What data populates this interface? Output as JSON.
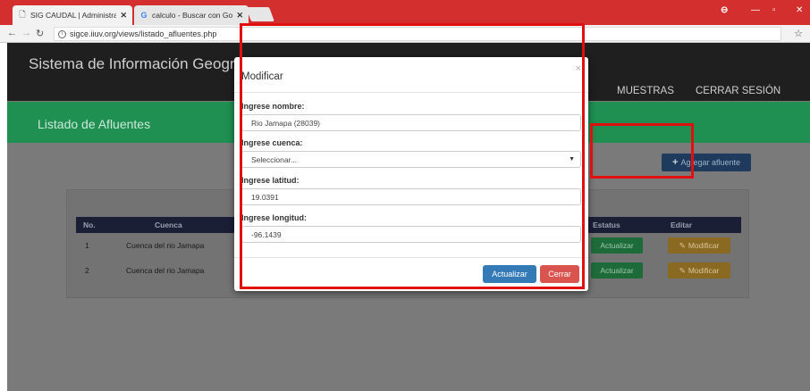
{
  "browser": {
    "tabs": [
      {
        "title": "SIG CAUDAL | Administra",
        "close": "✕"
      },
      {
        "title": "calculo - Buscar con Goo",
        "close": "✕"
      }
    ],
    "url": "sigce.iiuv.org/views/listado_afluentes.php",
    "window_controls": {
      "minimize": "—",
      "restore": "▫",
      "close": "✕"
    }
  },
  "page": {
    "site_title": "Sistema de Información Geogr",
    "nav": [
      "MUESTRAS",
      "CERRAR SESIÓN"
    ],
    "band_title": "Listado de Afluentes",
    "add_button": "Agregar afluente",
    "table": {
      "headers": [
        "No.",
        "Cuenca",
        "Estatus",
        "Editar"
      ],
      "rows": [
        {
          "no": "1",
          "cuenca": "Cuenca del rio Jamapa",
          "estatus": "Actualizar",
          "editar": "Modificar"
        },
        {
          "no": "2",
          "cuenca": "Cuenca del rio Jamapa",
          "estatus": "Actualizar",
          "editar": "Modificar"
        }
      ]
    }
  },
  "modal": {
    "title": "Modificar",
    "close": "×",
    "fields": {
      "nombre_label": "Ingrese nombre:",
      "nombre_value": "Rio Jamapa (28039)",
      "cuenca_label": "Ingrese cuenca:",
      "cuenca_value": "Seleccionar...",
      "latitud_label": "Ingrese latitud:",
      "latitud_value": "19.0391",
      "longitud_label": "Ingrese longitud:",
      "longitud_value": "-96.1439"
    },
    "buttons": {
      "update": "Actualizar",
      "cancel": "Cerrar"
    }
  },
  "colors": {
    "browser_frame": "#d32f2f",
    "header": "#1f1f1f",
    "band": "#1f8f52",
    "primary": "#337ab7",
    "danger": "#d9534f",
    "annotation": "#e01010"
  }
}
